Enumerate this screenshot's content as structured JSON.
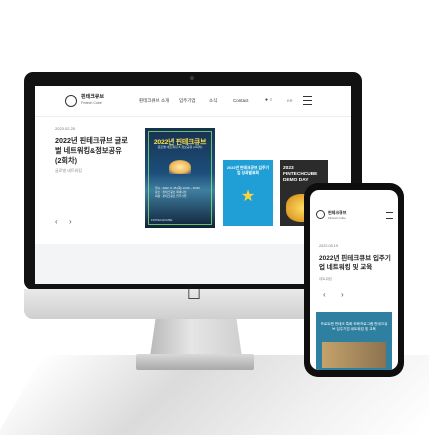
{
  "desktop": {
    "logo_text": "핀테크큐브",
    "logo_sub": "Fintech Cube",
    "nav": [
      "핀테크큐브 소개",
      "입주기업",
      "소식",
      "Contact"
    ],
    "lang": "KR",
    "date": "2023.02.25",
    "title": "2022년 핀테크큐브 글로벌 네트워킹&정보공유 (2회차)",
    "subtitle": "글로벌 네트워킹",
    "prev": "‹",
    "next": "›",
    "posters": {
      "main_title": "2022년 핀테크큐브",
      "main_subtitle": "글로벌 네트워킹 & 정보공유 (2회차)",
      "main_details": [
        "일시 : 2022. 8. 25.(목) 14:00 ~ 15:00",
        "장소 : 핀테크큐브 세미나실",
        "대상 : 핀테크큐브 입주기업"
      ],
      "main_footer": "FINTECHCUBE",
      "poster2_title": "2022년 핀테크큐브 입주기업 성과발표회",
      "poster3_title": "2023 FINTECHCUBE DEMO DAY"
    }
  },
  "mobile": {
    "logo_text": "핀테크큐브",
    "logo_sub": "Fintech Cube",
    "date": "2022.05.19",
    "title": "2022년 핀테크큐브 입주기업 네트워킹 및 교육",
    "subtitle": "네트워킹",
    "prev": "‹",
    "next": "›",
    "card_title": "프로트랜 핀테크 특화 보육프로그램 핀테크큐브 입주기업 네트워킹 및 교육"
  },
  "icons": {
    "apple": "apple-logo",
    "trophy": "trophy-icon"
  },
  "colors": {
    "poster_main": "#1d4e7b",
    "poster_accent": "#ffe14a",
    "poster2": "#1f9fd6",
    "poster3": "#2b2b2b"
  }
}
